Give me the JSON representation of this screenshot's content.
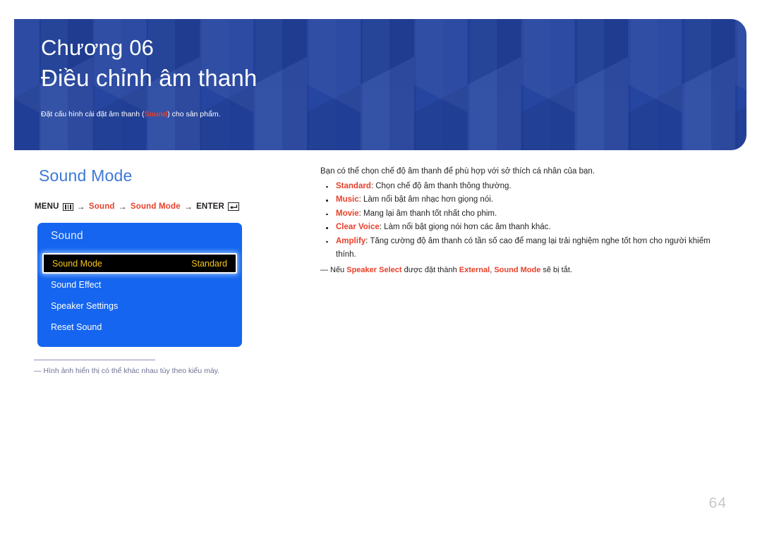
{
  "banner": {
    "chapter_label": "Chương 06",
    "chapter_title": "Điều chỉnh âm thanh",
    "desc_before": "Đặt cấu hình cài đặt âm thanh (",
    "desc_highlight": "Sound",
    "desc_after": ") cho sản phẩm.",
    "bg_color": "#22429e",
    "highlight_color": "#e8402a"
  },
  "section": {
    "title": "Sound Mode",
    "title_color": "#3d78d8"
  },
  "menu_path": {
    "menu_label": "MENU",
    "menu_icon": "menu-bars-icon",
    "arrow": "→",
    "step1": "Sound",
    "step2": "Sound Mode",
    "enter_label": "ENTER",
    "enter_icon": "enter-key-icon",
    "accent_color": "#e8402a"
  },
  "osd": {
    "title": "Sound",
    "bg_color": "#1565f0",
    "selected_text_color": "#f5c518",
    "rows": [
      {
        "label": "Sound Mode",
        "value": "Standard",
        "selected": true
      },
      {
        "label": "Sound Effect",
        "value": "",
        "selected": false
      },
      {
        "label": "Speaker Settings",
        "value": "",
        "selected": false
      },
      {
        "label": "Reset Sound",
        "value": "",
        "selected": false
      }
    ]
  },
  "left_note": {
    "dash": "―",
    "text": "Hình ảnh hiển thị có thể khác nhau tùy theo kiểu máy."
  },
  "right": {
    "intro": "Bạn có thể chọn chế độ âm thanh để phù hợp với sở thích cá nhân của bạn.",
    "bullets": [
      {
        "term": "Standard",
        "desc": ": Chọn chế độ âm thanh thông thường."
      },
      {
        "term": "Music",
        "desc": ": Làm nổi bật âm nhạc hơn giọng nói."
      },
      {
        "term": "Movie",
        "desc": ": Mang lại âm thanh tốt nhất cho phim."
      },
      {
        "term": "Clear Voice",
        "desc": ": Làm nổi bật giọng nói hơn các âm thanh khác."
      },
      {
        "term": "Amplify",
        "desc": ": Tăng cường độ âm thanh có tần số cao để mang lại trải nghiệm nghe tốt hơn cho người khiếm thính."
      }
    ],
    "note": {
      "dash": "―",
      "p1": "Nếu ",
      "b1": "Speaker Select",
      "p2": " được đặt thành ",
      "b2": "External",
      "p3": ", ",
      "b3": "Sound Mode",
      "p4": " sẽ bị tắt."
    }
  },
  "page_number": "64"
}
